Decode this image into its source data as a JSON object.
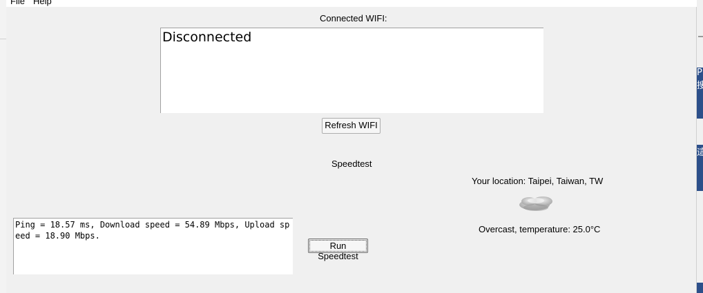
{
  "menubar": {
    "file": "File",
    "help": "Help"
  },
  "wifi": {
    "title": "Connected WIFI:",
    "status": "Disconnected",
    "refresh_label": "Refresh WIFI"
  },
  "speedtest": {
    "title": "Speedtest",
    "result": "Ping = 18.57 ms, Download speed = 54.89 Mbps, Upload speed = 18.90 Mbps.",
    "run_label": "Run Speedtest"
  },
  "weather": {
    "location": "Your location: Taipei, Taiwan, TW",
    "icon": "cloud-icon",
    "description": "Overcast, temperature: 25.0°C"
  },
  "background_right": {
    "text1": "P",
    "text2": "搜",
    "text3": "這"
  },
  "colors": {
    "window_bg": "#f0f0f0",
    "textbox_bg": "#ffffff",
    "background_accent": "#2c4f8a"
  }
}
